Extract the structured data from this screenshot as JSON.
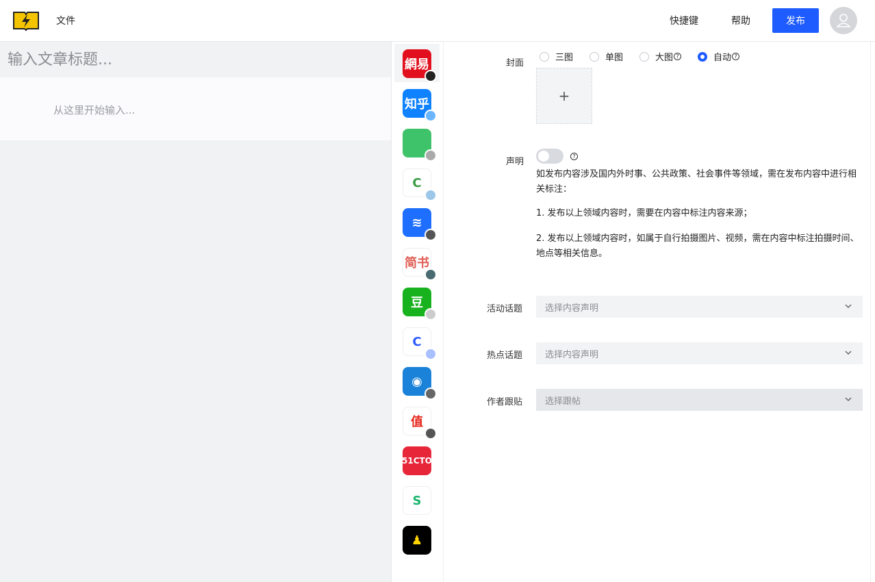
{
  "header": {
    "file_menu": "文件",
    "shortcut": "快捷键",
    "help": "帮助",
    "publish": "发布"
  },
  "editor": {
    "title_placeholder": "输入文章标题...",
    "body_placeholder": "从这里开始输入..."
  },
  "platforms": [
    {
      "name": "网易",
      "text": "網易",
      "color": "#e2101e",
      "fg": "#ffffff",
      "badge": "#222222",
      "selected": true
    },
    {
      "name": "知乎",
      "text": "知乎",
      "color": "#0f82ff",
      "fg": "#ffffff",
      "badge": "#69b6ff",
      "selected": false
    },
    {
      "name": "app3",
      "text": "",
      "color": "#3fc36a",
      "fg": "#ffffff",
      "badge": "#aaaaaa",
      "selected": false
    },
    {
      "name": "app4",
      "text": "C",
      "color": "#ffffff",
      "fg": "#3a9b45",
      "badge": "#9cc7e8",
      "selected": false
    },
    {
      "name": "app5",
      "text": "≋",
      "color": "#1e6fff",
      "fg": "#ffffff",
      "badge": "#555555",
      "selected": false
    },
    {
      "name": "简书",
      "text": "简书",
      "color": "#ffffff",
      "fg": "#e05c53",
      "badge": "#4a6b72",
      "selected": false
    },
    {
      "name": "豆",
      "text": "豆",
      "color": "#19b21f",
      "fg": "#ffffff",
      "badge": "#cccccc",
      "selected": false
    },
    {
      "name": "app8",
      "text": "C",
      "color": "#ffffff",
      "fg": "#2e5bff",
      "badge": "#a8c0ff",
      "selected": false
    },
    {
      "name": "app9",
      "text": "◉",
      "color": "#1a82d8",
      "fg": "#ffffff",
      "badge": "#666666",
      "selected": false
    },
    {
      "name": "值",
      "text": "值",
      "color": "#ffffff",
      "fg": "#e6261b",
      "badge": "#555555",
      "selected": false
    },
    {
      "name": "51CTO",
      "text": "51CTO",
      "color": "#e7263a",
      "fg": "#ffffff",
      "badge": "",
      "selected": false
    },
    {
      "name": "app12",
      "text": "S",
      "color": "#ffffff",
      "fg": "#1bb46d",
      "badge": "",
      "selected": false
    },
    {
      "name": "app13",
      "text": "♟",
      "color": "#000000",
      "fg": "#ffd400",
      "badge": "",
      "selected": false
    }
  ],
  "settings": {
    "cover_label": "封面",
    "cover_options": [
      {
        "label": "三图",
        "help": false,
        "checked": false
      },
      {
        "label": "单图",
        "help": false,
        "checked": false
      },
      {
        "label": "大图",
        "help": true,
        "checked": false
      },
      {
        "label": "自动",
        "help": true,
        "checked": true
      }
    ],
    "cover_add": "+",
    "declaration_label": "声明",
    "declaration_text": "如发布内容涉及国内外时事、公共政策、社会事件等领域，需在发布内容中进行相关标注：",
    "declaration_item1": "1. 发布以上领域内容时，需要在内容中标注内容来源；",
    "declaration_item2": "2. 发布以上领域内容时，如属于自行拍摄图片、视频，需在内容中标注拍摄时间、地点等相关信息。",
    "activity_label": "活动话题",
    "activity_placeholder": "选择内容声明",
    "hot_label": "热点话题",
    "hot_placeholder": "选择内容声明",
    "follow_label": "作者跟贴",
    "follow_placeholder": "选择跟帖"
  },
  "colors": {
    "accent": "#1f5cff"
  }
}
